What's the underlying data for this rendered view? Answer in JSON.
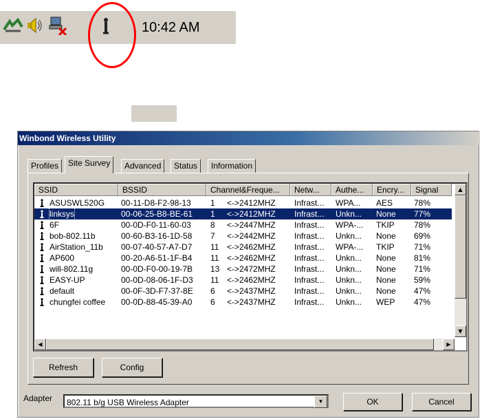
{
  "tray": {
    "clock": "10:42 AM",
    "icons": [
      "network-icon",
      "speaker-icon",
      "network-disconnected-icon",
      "wireless-utility-icon"
    ]
  },
  "dialog": {
    "title": "Winbond Wireless Utility",
    "tabs": [
      {
        "label": "Profiles",
        "active": false
      },
      {
        "label": "Site Survey",
        "active": true
      },
      {
        "label": "Advanced",
        "active": false
      },
      {
        "label": "Status",
        "active": false
      },
      {
        "label": "Information",
        "active": false
      }
    ],
    "columns": [
      "SSID",
      "BSSID",
      "Channel&Freque...",
      "Netw...",
      "Authe...",
      "Encry...",
      "Signal"
    ],
    "rows": [
      {
        "ssid": "ASUSWL520G",
        "bssid": "00-11-D8-F2-98-13",
        "channel": "1",
        "freq": "<->2412MHZ",
        "net": "Infrast...",
        "auth": "WPA...",
        "enc": "AES",
        "signal": "78%",
        "selected": false
      },
      {
        "ssid": "linksys",
        "bssid": "00-06-25-B8-BE-61",
        "channel": "1",
        "freq": "<->2412MHZ",
        "net": "Infrast...",
        "auth": "Unkn...",
        "enc": "None",
        "signal": "77%",
        "selected": true
      },
      {
        "ssid": "6F",
        "bssid": "00-0D-F0-11-60-03",
        "channel": "8",
        "freq": "<->2447MHZ",
        "net": "Infrast...",
        "auth": "WPA-...",
        "enc": "TKIP",
        "signal": "78%",
        "selected": false
      },
      {
        "ssid": "bob-802.11b",
        "bssid": "00-60-B3-16-1D-58",
        "channel": "7",
        "freq": "<->2442MHZ",
        "net": "Infrast...",
        "auth": "Unkn...",
        "enc": "None",
        "signal": "69%",
        "selected": false
      },
      {
        "ssid": "AirStation_11b",
        "bssid": "00-07-40-57-A7-D7",
        "channel": "11",
        "freq": "<->2462MHZ",
        "net": "Infrast...",
        "auth": "WPA-...",
        "enc": "TKIP",
        "signal": "71%",
        "selected": false
      },
      {
        "ssid": "AP600",
        "bssid": "00-20-A6-51-1F-B4",
        "channel": "11",
        "freq": "<->2462MHZ",
        "net": "Infrast...",
        "auth": "Unkn...",
        "enc": "None",
        "signal": "81%",
        "selected": false
      },
      {
        "ssid": "will-802.11g",
        "bssid": "00-0D-F0-00-19-7B",
        "channel": "13",
        "freq": "<->2472MHZ",
        "net": "Infrast...",
        "auth": "Unkn...",
        "enc": "None",
        "signal": "71%",
        "selected": false
      },
      {
        "ssid": "EASY-UP",
        "bssid": "00-0D-08-06-1F-D3",
        "channel": "11",
        "freq": "<->2462MHZ",
        "net": "Infrast...",
        "auth": "Unkn...",
        "enc": "None",
        "signal": "59%",
        "selected": false
      },
      {
        "ssid": "default",
        "bssid": "00-0F-3D-F7-37-8E",
        "channel": "6",
        "freq": "<->2437MHZ",
        "net": "Infrast...",
        "auth": "Unkn...",
        "enc": "None",
        "signal": "47%",
        "selected": false
      },
      {
        "ssid": "chungfei coffee",
        "bssid": "00-0D-88-45-39-A0",
        "channel": "6",
        "freq": "<->2437MHZ",
        "net": "Infrast...",
        "auth": "Unkn...",
        "enc": "WEP",
        "signal": "47%",
        "selected": false
      }
    ],
    "buttons": {
      "refresh": "Refresh",
      "config": "Config",
      "ok": "OK",
      "cancel": "Cancel"
    },
    "adapter": {
      "label": "Adapter",
      "value": "802.11 b/g USB Wireless Adapter"
    }
  },
  "colors": {
    "selection": "#0a246a",
    "face": "#d4d0c8",
    "highlight_ring": "#ff0000"
  }
}
